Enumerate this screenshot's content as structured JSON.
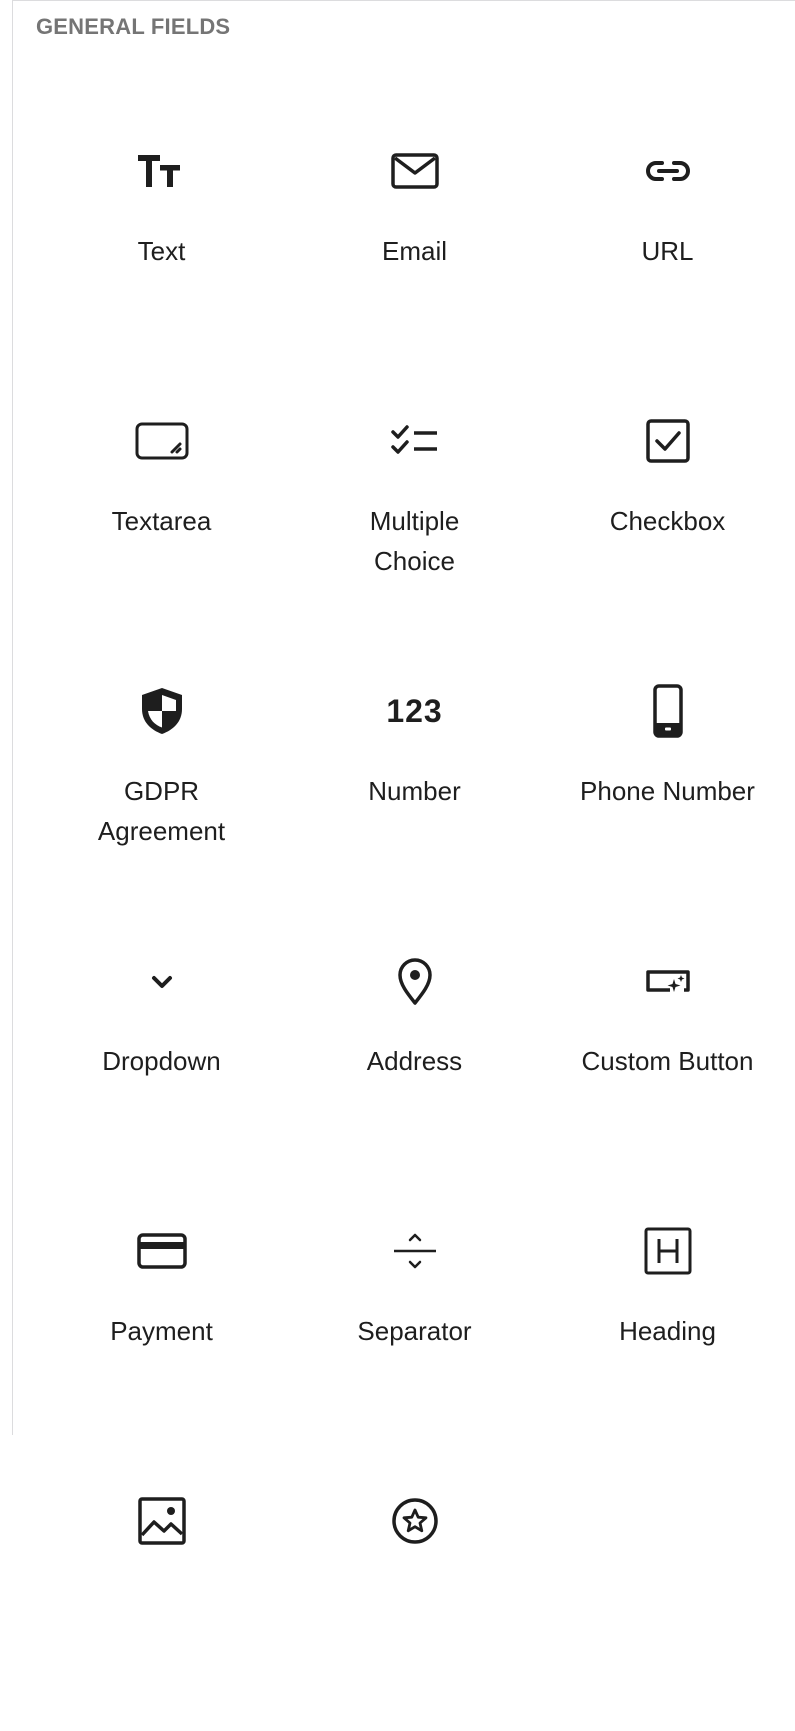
{
  "section": {
    "title": "GENERAL FIELDS"
  },
  "blocks": [
    {
      "label": "Text",
      "icon": "text-format-icon"
    },
    {
      "label": "Email",
      "icon": "envelope-icon"
    },
    {
      "label": "URL",
      "icon": "link-icon"
    },
    {
      "label": "Textarea",
      "icon": "textarea-icon"
    },
    {
      "label": "Multiple\nChoice",
      "icon": "checklist-icon"
    },
    {
      "label": "Checkbox",
      "icon": "checkbox-icon"
    },
    {
      "label": "GDPR\nAgreement",
      "icon": "shield-icon"
    },
    {
      "label": "Number",
      "icon": "number-icon",
      "icon_text": "123"
    },
    {
      "label": "Phone Number",
      "icon": "phone-icon"
    },
    {
      "label": "Dropdown",
      "icon": "chevron-down-icon"
    },
    {
      "label": "Address",
      "icon": "location-pin-icon"
    },
    {
      "label": "Custom Button",
      "icon": "custom-button-icon"
    },
    {
      "label": "Payment",
      "icon": "credit-card-icon"
    },
    {
      "label": "Separator",
      "icon": "separator-icon"
    },
    {
      "label": "Heading",
      "icon": "heading-icon"
    },
    {
      "label": "",
      "icon": "image-icon"
    },
    {
      "label": "",
      "icon": "star-badge-icon"
    }
  ]
}
